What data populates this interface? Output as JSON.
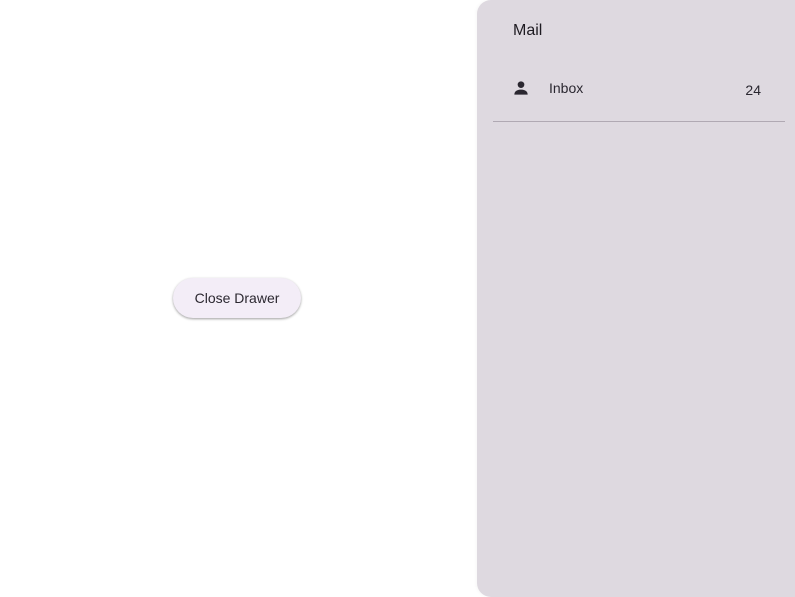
{
  "main": {
    "close_button_label": "Close Drawer"
  },
  "drawer": {
    "title": "Mail",
    "items": [
      {
        "icon": "person-icon",
        "label": "Inbox",
        "count": "24"
      }
    ]
  },
  "colors": {
    "drawer_background": "#ded9e0",
    "button_background": "#f3edf7",
    "text_primary": "#1e1b22"
  }
}
